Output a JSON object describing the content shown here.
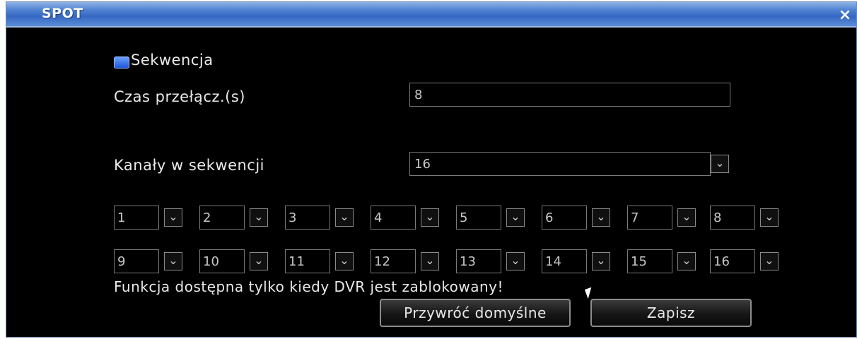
{
  "window": {
    "title": "SPOT",
    "close_symbol": "×"
  },
  "sequence": {
    "label": "Sekwencja",
    "checked": true
  },
  "switch_time": {
    "label": "Czas przełącz.(s)",
    "value": "8"
  },
  "channels_in_sequence": {
    "label": "Kanały w sekwencji",
    "value": "16"
  },
  "channel_slots": [
    {
      "value": "1"
    },
    {
      "value": "2"
    },
    {
      "value": "3"
    },
    {
      "value": "4"
    },
    {
      "value": "5"
    },
    {
      "value": "6"
    },
    {
      "value": "7"
    },
    {
      "value": "8"
    },
    {
      "value": "9"
    },
    {
      "value": "10"
    },
    {
      "value": "11"
    },
    {
      "value": "12"
    },
    {
      "value": "13"
    },
    {
      "value": "14"
    },
    {
      "value": "15"
    },
    {
      "value": "16"
    }
  ],
  "notice": "Funkcja dostępna tylko kiedy DVR jest zablokowany!",
  "buttons": {
    "restore_defaults": "Przywróć domyślne",
    "save": "Zapisz"
  },
  "icons": {
    "dropdown": "chevron-down-icon"
  },
  "colors": {
    "title_bar": "#4c7fd0",
    "background": "#000000",
    "checkbox": "#1e56d8"
  }
}
